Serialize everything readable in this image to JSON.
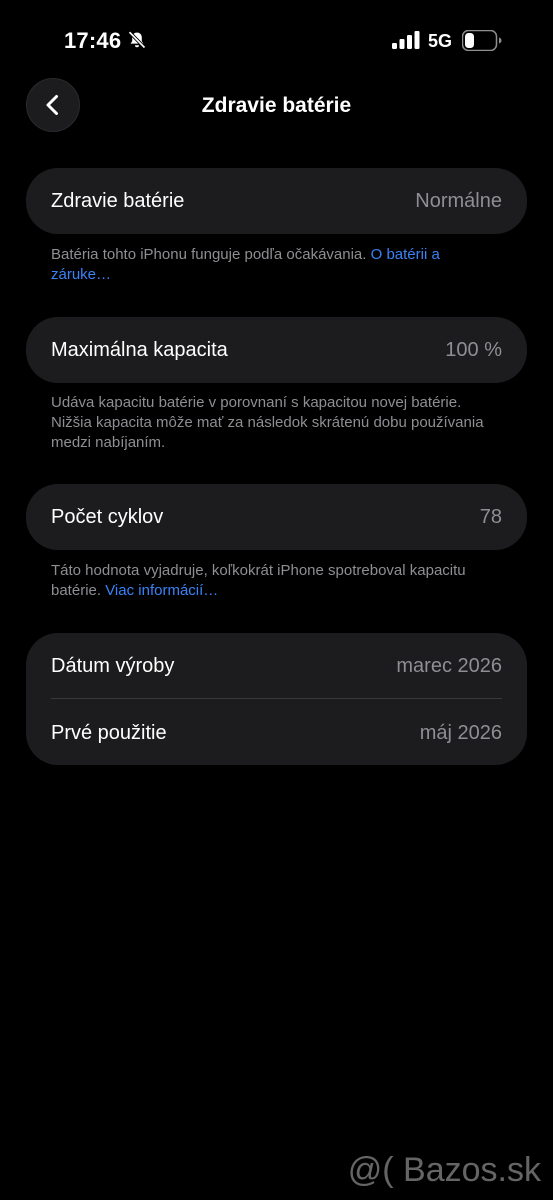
{
  "status_bar": {
    "time": "17:46",
    "network": "5G"
  },
  "nav": {
    "title": "Zdravie batérie"
  },
  "battery_health": {
    "label": "Zdravie batérie",
    "value": "Normálne",
    "note_text": "Batéria tohto iPhonu funguje podľa očakávania. ",
    "note_link": "O batérii a záruke…"
  },
  "max_capacity": {
    "label": "Maximálna kapacita",
    "value": "100 %",
    "note_text": "Udáva kapacitu batérie v porovnaní s kapacitou novej batérie. Nižšia kapacita môže mať za následok skrátenú dobu používania medzi nabíjaním."
  },
  "cycle_count": {
    "label": "Počet cyklov",
    "value": "78",
    "note_text": "Táto hodnota vyjadruje, koľkokrát iPhone spotreboval kapacitu batérie. ",
    "note_link": "Viac informácií…"
  },
  "dates": {
    "manufacture_label": "Dátum výroby",
    "manufacture_value": "marec 2026",
    "first_use_label": "Prvé použitie",
    "first_use_value": "máj 2026"
  },
  "watermark": {
    "text": "@( Bazos.sk"
  },
  "colors": {
    "background": "#000000",
    "card": "#1c1c1e",
    "secondary_text": "#8e8e93",
    "link": "#3a82f7"
  },
  "icons": {
    "back": "chevron-left-icon",
    "mute": "bell-slash-icon",
    "signal": "cellular-signal-icon",
    "battery": "battery-icon"
  }
}
